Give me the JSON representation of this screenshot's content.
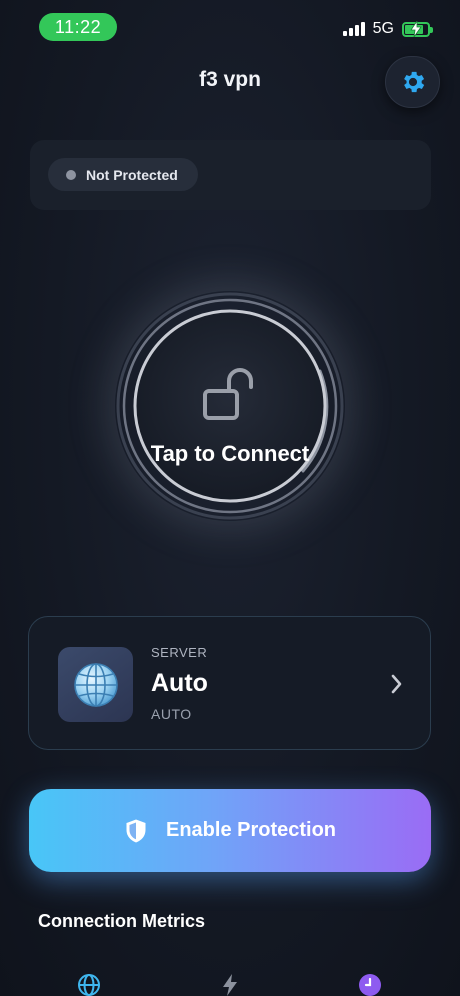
{
  "status_bar": {
    "time": "11:22",
    "network": "5G"
  },
  "header": {
    "title": "f3 vpn"
  },
  "status": {
    "label": "Not Protected"
  },
  "connect": {
    "label": "Tap to Connect"
  },
  "server": {
    "kicker": "SERVER",
    "name": "Auto",
    "subtitle": "AUTO"
  },
  "actions": {
    "enable_label": "Enable Protection"
  },
  "metrics": {
    "title": "Connection Metrics"
  },
  "colors": {
    "accent_cyan": "#48c6f7",
    "accent_purple": "#9a6cf5",
    "status_green": "#33c759",
    "settings_icon": "#2fa8f0"
  },
  "icons": {
    "settings": "gear-icon",
    "lock": "unlocked-padlock-icon",
    "server": "globe-icon",
    "chevron": "chevron-right-icon",
    "shield": "shield-icon",
    "metric_1": "globe-icon",
    "metric_2": "lightning-bolt-icon",
    "metric_3": "clock-icon"
  }
}
